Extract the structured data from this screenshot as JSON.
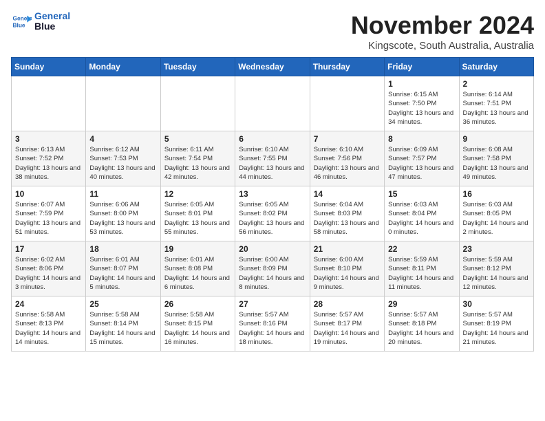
{
  "logo": {
    "line1": "General",
    "line2": "Blue"
  },
  "title": "November 2024",
  "location": "Kingscote, South Australia, Australia",
  "days_of_week": [
    "Sunday",
    "Monday",
    "Tuesday",
    "Wednesday",
    "Thursday",
    "Friday",
    "Saturday"
  ],
  "weeks": [
    [
      {
        "num": "",
        "info": ""
      },
      {
        "num": "",
        "info": ""
      },
      {
        "num": "",
        "info": ""
      },
      {
        "num": "",
        "info": ""
      },
      {
        "num": "",
        "info": ""
      },
      {
        "num": "1",
        "info": "Sunrise: 6:15 AM\nSunset: 7:50 PM\nDaylight: 13 hours and 34 minutes."
      },
      {
        "num": "2",
        "info": "Sunrise: 6:14 AM\nSunset: 7:51 PM\nDaylight: 13 hours and 36 minutes."
      }
    ],
    [
      {
        "num": "3",
        "info": "Sunrise: 6:13 AM\nSunset: 7:52 PM\nDaylight: 13 hours and 38 minutes."
      },
      {
        "num": "4",
        "info": "Sunrise: 6:12 AM\nSunset: 7:53 PM\nDaylight: 13 hours and 40 minutes."
      },
      {
        "num": "5",
        "info": "Sunrise: 6:11 AM\nSunset: 7:54 PM\nDaylight: 13 hours and 42 minutes."
      },
      {
        "num": "6",
        "info": "Sunrise: 6:10 AM\nSunset: 7:55 PM\nDaylight: 13 hours and 44 minutes."
      },
      {
        "num": "7",
        "info": "Sunrise: 6:10 AM\nSunset: 7:56 PM\nDaylight: 13 hours and 46 minutes."
      },
      {
        "num": "8",
        "info": "Sunrise: 6:09 AM\nSunset: 7:57 PM\nDaylight: 13 hours and 47 minutes."
      },
      {
        "num": "9",
        "info": "Sunrise: 6:08 AM\nSunset: 7:58 PM\nDaylight: 13 hours and 49 minutes."
      }
    ],
    [
      {
        "num": "10",
        "info": "Sunrise: 6:07 AM\nSunset: 7:59 PM\nDaylight: 13 hours and 51 minutes."
      },
      {
        "num": "11",
        "info": "Sunrise: 6:06 AM\nSunset: 8:00 PM\nDaylight: 13 hours and 53 minutes."
      },
      {
        "num": "12",
        "info": "Sunrise: 6:05 AM\nSunset: 8:01 PM\nDaylight: 13 hours and 55 minutes."
      },
      {
        "num": "13",
        "info": "Sunrise: 6:05 AM\nSunset: 8:02 PM\nDaylight: 13 hours and 56 minutes."
      },
      {
        "num": "14",
        "info": "Sunrise: 6:04 AM\nSunset: 8:03 PM\nDaylight: 13 hours and 58 minutes."
      },
      {
        "num": "15",
        "info": "Sunrise: 6:03 AM\nSunset: 8:04 PM\nDaylight: 14 hours and 0 minutes."
      },
      {
        "num": "16",
        "info": "Sunrise: 6:03 AM\nSunset: 8:05 PM\nDaylight: 14 hours and 2 minutes."
      }
    ],
    [
      {
        "num": "17",
        "info": "Sunrise: 6:02 AM\nSunset: 8:06 PM\nDaylight: 14 hours and 3 minutes."
      },
      {
        "num": "18",
        "info": "Sunrise: 6:01 AM\nSunset: 8:07 PM\nDaylight: 14 hours and 5 minutes."
      },
      {
        "num": "19",
        "info": "Sunrise: 6:01 AM\nSunset: 8:08 PM\nDaylight: 14 hours and 6 minutes."
      },
      {
        "num": "20",
        "info": "Sunrise: 6:00 AM\nSunset: 8:09 PM\nDaylight: 14 hours and 8 minutes."
      },
      {
        "num": "21",
        "info": "Sunrise: 6:00 AM\nSunset: 8:10 PM\nDaylight: 14 hours and 9 minutes."
      },
      {
        "num": "22",
        "info": "Sunrise: 5:59 AM\nSunset: 8:11 PM\nDaylight: 14 hours and 11 minutes."
      },
      {
        "num": "23",
        "info": "Sunrise: 5:59 AM\nSunset: 8:12 PM\nDaylight: 14 hours and 12 minutes."
      }
    ],
    [
      {
        "num": "24",
        "info": "Sunrise: 5:58 AM\nSunset: 8:13 PM\nDaylight: 14 hours and 14 minutes."
      },
      {
        "num": "25",
        "info": "Sunrise: 5:58 AM\nSunset: 8:14 PM\nDaylight: 14 hours and 15 minutes."
      },
      {
        "num": "26",
        "info": "Sunrise: 5:58 AM\nSunset: 8:15 PM\nDaylight: 14 hours and 16 minutes."
      },
      {
        "num": "27",
        "info": "Sunrise: 5:57 AM\nSunset: 8:16 PM\nDaylight: 14 hours and 18 minutes."
      },
      {
        "num": "28",
        "info": "Sunrise: 5:57 AM\nSunset: 8:17 PM\nDaylight: 14 hours and 19 minutes."
      },
      {
        "num": "29",
        "info": "Sunrise: 5:57 AM\nSunset: 8:18 PM\nDaylight: 14 hours and 20 minutes."
      },
      {
        "num": "30",
        "info": "Sunrise: 5:57 AM\nSunset: 8:19 PM\nDaylight: 14 hours and 21 minutes."
      }
    ]
  ]
}
